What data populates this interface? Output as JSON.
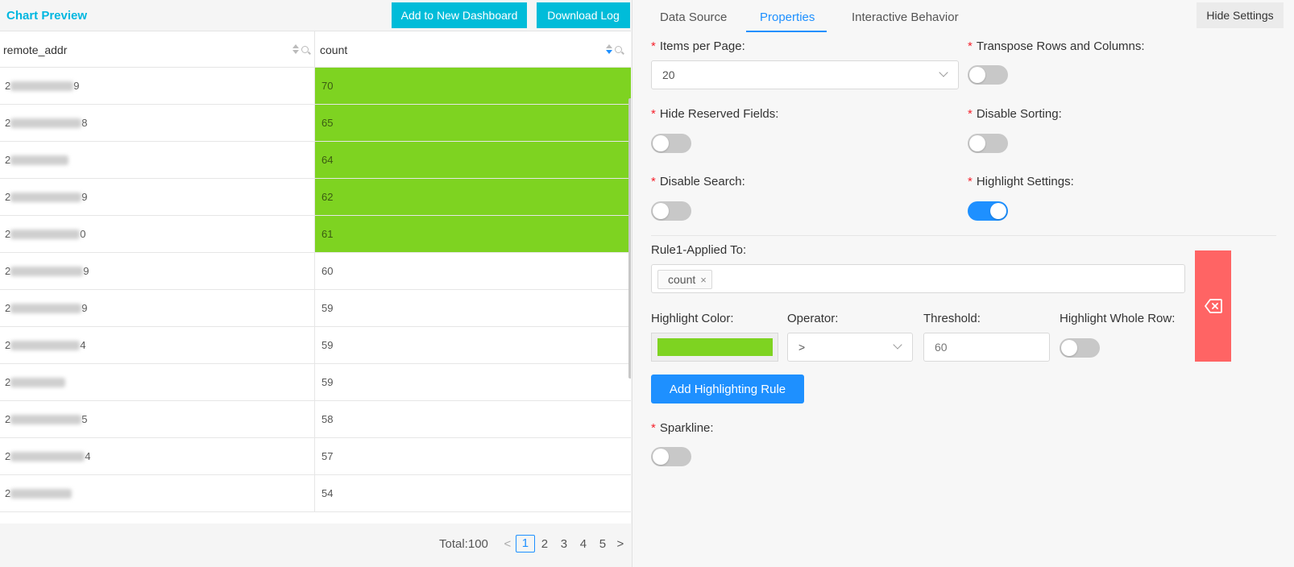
{
  "preview": {
    "title": "Chart Preview",
    "add_dashboard_label": "Add to New Dashboard",
    "download_label": "Download Log"
  },
  "table": {
    "columns": [
      "remote_addr",
      "count"
    ],
    "rows": [
      {
        "addr_prefix": "2",
        "addr_suffix": "9",
        "count": "70",
        "highlight": true
      },
      {
        "addr_prefix": "2",
        "addr_suffix": "8",
        "count": "65",
        "highlight": true
      },
      {
        "addr_prefix": "2",
        "addr_suffix": "",
        "count": "64",
        "highlight": true
      },
      {
        "addr_prefix": "2",
        "addr_suffix": "9",
        "count": "62",
        "highlight": true
      },
      {
        "addr_prefix": "2",
        "addr_suffix": "0",
        "count": "61",
        "highlight": true
      },
      {
        "addr_prefix": "2",
        "addr_suffix": "9",
        "count": "60",
        "highlight": false
      },
      {
        "addr_prefix": "2",
        "addr_suffix": "9",
        "count": "59",
        "highlight": false
      },
      {
        "addr_prefix": "2",
        "addr_suffix": "4",
        "count": "59",
        "highlight": false
      },
      {
        "addr_prefix": "2",
        "addr_suffix": "",
        "count": "59",
        "highlight": false
      },
      {
        "addr_prefix": "2",
        "addr_suffix": "5",
        "count": "58",
        "highlight": false
      },
      {
        "addr_prefix": "2",
        "addr_suffix": "4",
        "count": "57",
        "highlight": false
      },
      {
        "addr_prefix": "2",
        "addr_suffix": "",
        "count": "54",
        "highlight": false
      }
    ]
  },
  "pagination": {
    "total_label": "Total:100",
    "prev": "<",
    "pages": [
      "1",
      "2",
      "3",
      "4",
      "5"
    ],
    "current": "1",
    "next": ">"
  },
  "settings": {
    "tabs": [
      "Data Source",
      "Properties",
      "Interactive Behavior"
    ],
    "active_tab": "Properties",
    "hide_label": "Hide Settings",
    "items_per_page_label": "Items per Page:",
    "items_per_page_value": "20",
    "transpose_label": "Transpose Rows and Columns:",
    "transpose_on": false,
    "hide_reserved_label": "Hide Reserved Fields:",
    "hide_reserved_on": false,
    "disable_sorting_label": "Disable Sorting:",
    "disable_sorting_on": false,
    "disable_search_label": "Disable Search:",
    "disable_search_on": false,
    "highlight_settings_label": "Highlight Settings:",
    "highlight_settings_on": true,
    "rule_applied_label": "Rule1-Applied To:",
    "rule_tag": "count",
    "rule_tag_remove": "×",
    "highlight_color_label": "Highlight Color:",
    "highlight_color": "#7ed321",
    "operator_label": "Operator:",
    "operator_value": ">",
    "threshold_label": "Threshold:",
    "threshold_value": "60",
    "whole_row_label": "Highlight Whole Row:",
    "whole_row_on": false,
    "add_rule_label": "Add Highlighting Rule",
    "sparkline_label": "Sparkline:",
    "sparkline_on": false
  },
  "colors": {
    "accent_cyan": "#00bcd9",
    "accent_blue": "#1e90ff",
    "highlight_green": "#7ed321",
    "delete_red": "#ff6464"
  }
}
